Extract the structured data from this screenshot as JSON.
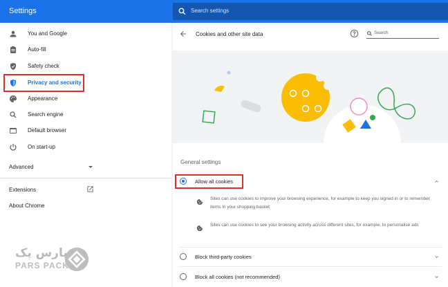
{
  "app": {
    "title": "Settings"
  },
  "search": {
    "placeholder": "Search settings"
  },
  "sidebar": {
    "items": [
      {
        "label": "You and Google",
        "icon": "person-icon"
      },
      {
        "label": "Auto-fill",
        "icon": "clipboard-icon"
      },
      {
        "label": "Safety check",
        "icon": "shield-check-icon"
      },
      {
        "label": "Privacy and security",
        "icon": "shield-icon",
        "active": true
      },
      {
        "label": "Appearance",
        "icon": "palette-icon"
      },
      {
        "label": "Search engine",
        "icon": "search-icon"
      },
      {
        "label": "Default browser",
        "icon": "browser-icon"
      },
      {
        "label": "On start-up",
        "icon": "power-icon"
      }
    ],
    "advanced": "Advanced",
    "extensions": "Extensions",
    "about": "About Chrome"
  },
  "panel": {
    "title": "Cookies and other site data",
    "search_placeholder": "Search",
    "section_title": "General settings",
    "options": [
      {
        "label": "Allow all cookies",
        "selected": true,
        "expanded": true
      },
      {
        "label": "Block third-party cookies",
        "selected": false
      },
      {
        "label": "Block all cookies (not recommended)",
        "selected": false
      }
    ],
    "descriptions": [
      "Sites can use cookies to improve your browsing experience, for example to keep you signed in or to remember items in your shopping basket",
      "Sites can use cookies to see your browsing activity across different sites, for example, to personalise ads"
    ]
  },
  "watermark": {
    "text_fa": "پارس پک",
    "text_en": "PARS PACK"
  },
  "colors": {
    "accent": "#1a73e8",
    "highlight": "#d93025",
    "cookie": "#fbbc04"
  }
}
